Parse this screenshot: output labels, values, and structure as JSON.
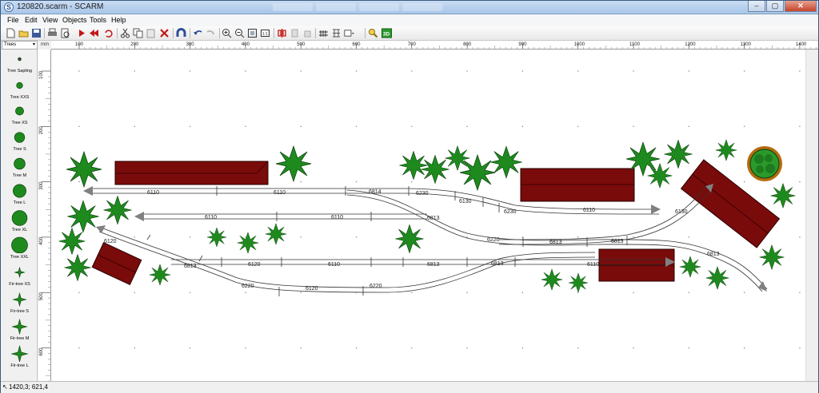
{
  "window": {
    "title": "120820.scarm - SCARM"
  },
  "menu": [
    "File",
    "Edit",
    "View",
    "Objects",
    "Tools",
    "Help"
  ],
  "toolbar_icons": [
    "new-icon",
    "open-icon",
    "save-icon",
    "print-icon",
    "print-preview-icon",
    "play-icon",
    "rewind-icon",
    "cut-icon",
    "copy-icon",
    "paste-icon",
    "delete-icon",
    "magnet-icon",
    "undo-icon",
    "redo-icon",
    "zoom-in-icon",
    "zoom-out-icon",
    "zoom-fit-icon",
    "zoom-11-icon",
    "flip-icon",
    "align-icon",
    "align2-icon",
    "track-icon",
    "train-icon",
    "layer-icon",
    "find-icon",
    "3d-view-icon"
  ],
  "palette": {
    "category": "Trees",
    "items": [
      "Tree Sapling",
      "Tree XXS",
      "Tree XS",
      "Tree S",
      "Tree M",
      "Tree L",
      "Tree XL",
      "Tree XXL",
      "Fir-tree XS",
      "Fir-tree S",
      "Fir-tree M",
      "Fir-tree L"
    ]
  },
  "ruler": {
    "unit": "mm",
    "top_labels": [
      "100",
      "200",
      "300",
      "400",
      "500",
      "600",
      "700",
      "800",
      "900",
      "1000",
      "1100",
      "1200",
      "1300",
      "1400"
    ],
    "left_labels": [
      "100",
      "200",
      "300",
      "400",
      "500",
      "600"
    ]
  },
  "track_labels": {
    "top_row": [
      "6110",
      "6110",
      "6814",
      "6230",
      "6130",
      "6230",
      "6110",
      "6130"
    ],
    "mid_row": [
      "6110",
      "6110",
      "6813",
      "6220",
      "6813",
      "6813"
    ],
    "low_row": [
      "6120",
      "6813",
      "6120",
      "6110",
      "6813",
      "6813",
      "6110",
      "6813"
    ],
    "bottom_row": [
      "6220",
      "6120",
      "6220"
    ]
  },
  "colors": {
    "building": "#7a0b0b",
    "tree": "#1e8a1e",
    "tree_dark": "#0f5a0f",
    "track": "#333333",
    "arrow": "#808080"
  },
  "status": {
    "coords": "1420,3; 621,4"
  }
}
